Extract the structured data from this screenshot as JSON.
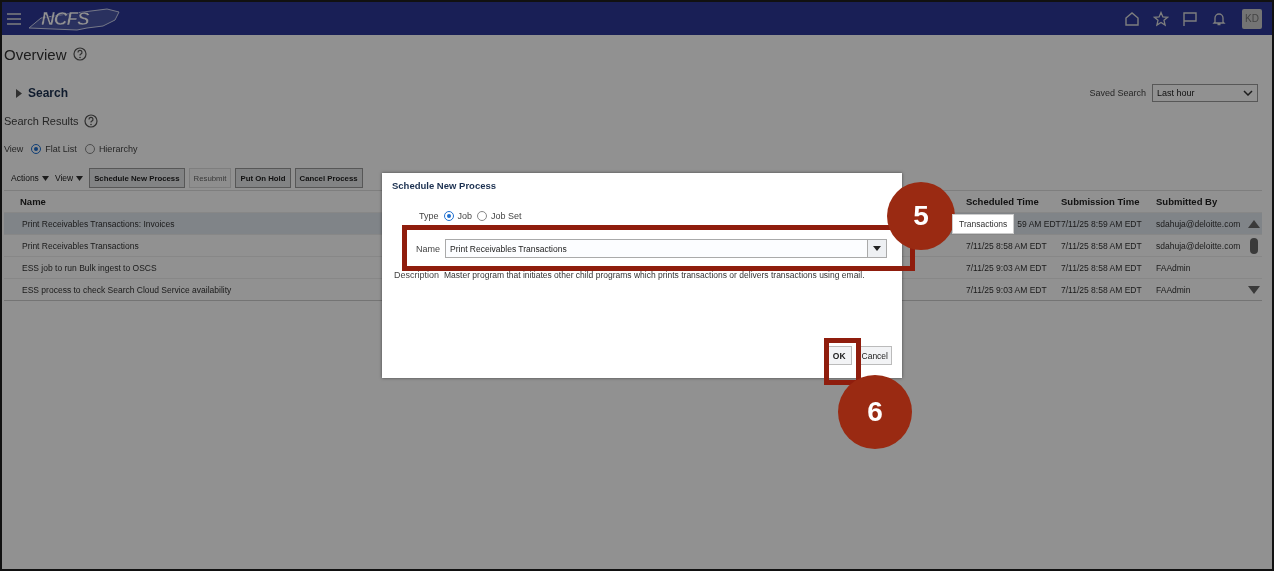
{
  "header": {
    "logo": "NCFS",
    "avatar": "KD"
  },
  "page": {
    "title": "Overview",
    "search_label": "Search",
    "saved_search": {
      "label": "Saved Search",
      "value": "Last hour"
    },
    "results_title": "Search Results",
    "view": {
      "label": "View",
      "options": [
        {
          "label": "Flat List",
          "selected": true
        },
        {
          "label": "Hierarchy",
          "selected": false
        }
      ]
    },
    "toolbar": {
      "menus": [
        "Actions",
        "View"
      ],
      "buttons": [
        {
          "label": "Schedule New Process",
          "disabled": false
        },
        {
          "label": "Resubmit",
          "disabled": true
        },
        {
          "label": "Put On Hold",
          "disabled": false
        },
        {
          "label": "Cancel Process",
          "disabled": false
        }
      ]
    },
    "table": {
      "columns": [
        "Name",
        "Scheduled Time",
        "Submission Time",
        "Submitted By"
      ],
      "rows": [
        {
          "selected": true,
          "tooltip": "Transactions",
          "cells": [
            "Print Receivables Transactions: Invoices",
            "59 AM EDT",
            "7/11/25 8:59 AM EDT",
            "sdahuja@deloitte.com"
          ]
        },
        {
          "selected": false,
          "cells": [
            "Print Receivables Transactions",
            "7/11/25 8:58 AM EDT",
            "7/11/25 8:58 AM EDT",
            "sdahuja@deloitte.com"
          ]
        },
        {
          "selected": false,
          "cells": [
            "ESS job to run Bulk ingest to OSCS",
            "7/11/25 9:03 AM EDT",
            "7/11/25 8:58 AM EDT",
            "FAAdmin"
          ]
        },
        {
          "selected": false,
          "cells": [
            "ESS process to check Search Cloud Service availability",
            "7/11/25 9:03 AM EDT",
            "7/11/25 8:58 AM EDT",
            "FAAdmin"
          ]
        }
      ]
    }
  },
  "dialog": {
    "title": "Schedule New Process",
    "type": {
      "label": "Type",
      "options": [
        {
          "label": "Job",
          "selected": true
        },
        {
          "label": "Job Set",
          "selected": false
        }
      ]
    },
    "name": {
      "label": "Name",
      "value": "Print Receivables Transactions"
    },
    "description": {
      "label": "Description",
      "text": "Master program that initiates other child programs which prints transactions or delivers transactions using email."
    },
    "buttons": [
      {
        "label": "OK",
        "kind": "primary"
      },
      {
        "label": "Cancel",
        "kind": "normal"
      }
    ]
  },
  "callouts": [
    {
      "label": "5"
    },
    {
      "label": "6"
    }
  ]
}
